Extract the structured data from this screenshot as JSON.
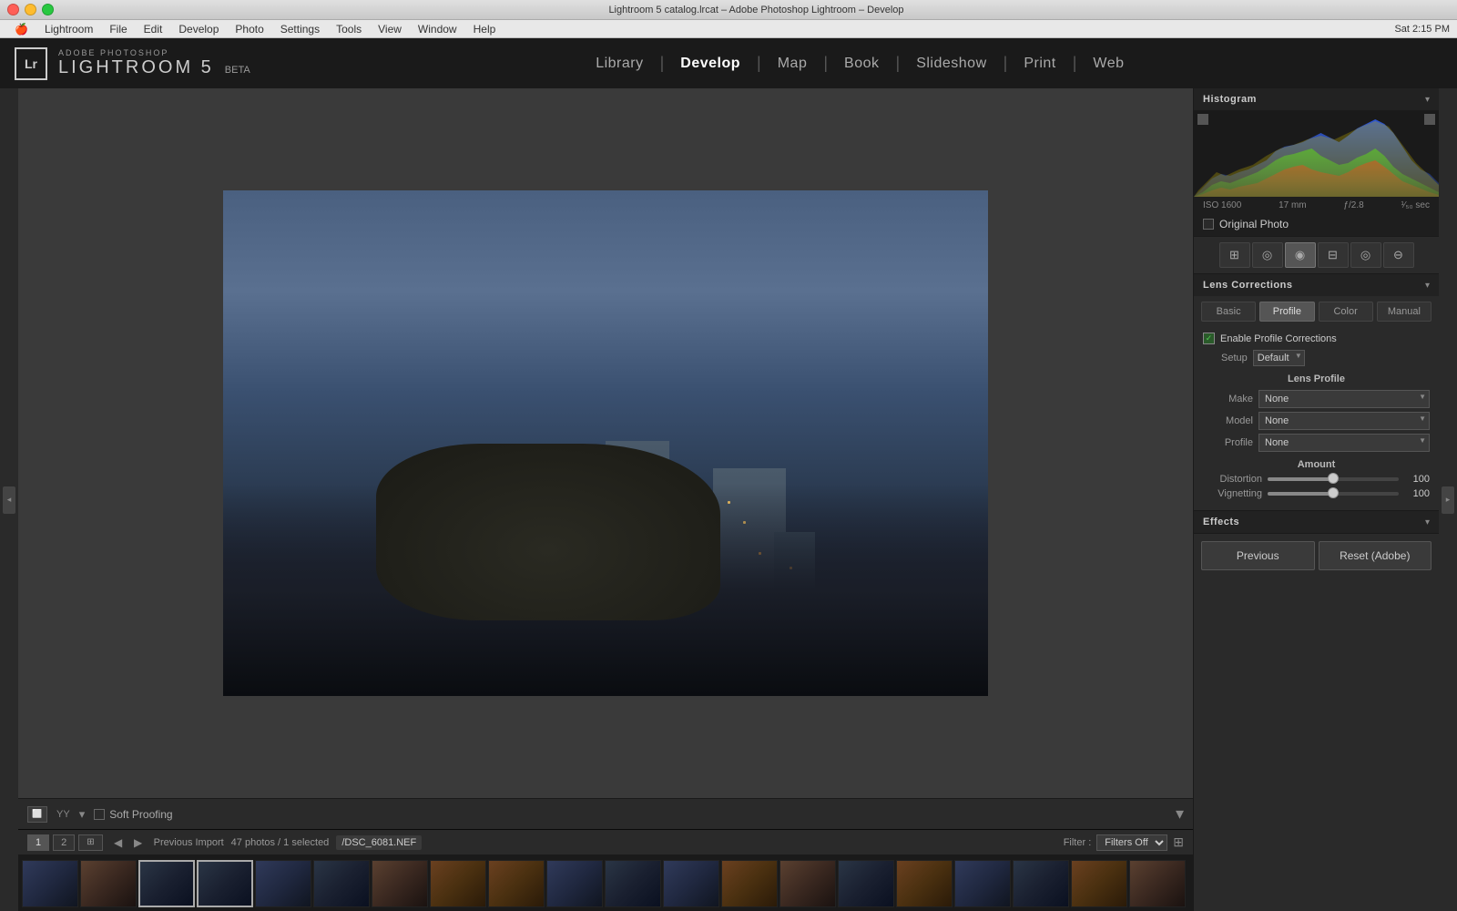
{
  "window": {
    "title": "Lightroom 5 catalog.lrcat – Adobe Photoshop Lightroom – Develop",
    "close_label": "×",
    "minimize_label": "–",
    "maximize_label": "+"
  },
  "mac_menu": {
    "items": [
      "🍎",
      "Lightroom",
      "File",
      "Edit",
      "Develop",
      "Photo",
      "Settings",
      "Tools",
      "View",
      "Window",
      "Help"
    ]
  },
  "app": {
    "logo_sub": "ADOBE PHOTOSHOP",
    "logo_main": "LIGHTROOM 5",
    "logo_beta": "BETA",
    "lr_icon": "Lr"
  },
  "nav": {
    "items": [
      "Library",
      "Develop",
      "Map",
      "Book",
      "Slideshow",
      "Print",
      "Web"
    ],
    "active": "Develop",
    "separators": [
      "|",
      "|",
      "|",
      "|",
      "|",
      "|"
    ]
  },
  "histogram": {
    "title": "Histogram",
    "meta": {
      "iso": "ISO 1600",
      "focal": "17 mm",
      "aperture": "ƒ/2.8",
      "shutter": "¹⁄₅₀ sec"
    },
    "original_photo_label": "Original Photo"
  },
  "tools": {
    "buttons": [
      "⊞",
      "◎",
      "◉",
      "⊟",
      "◎",
      "⊖"
    ]
  },
  "lens_corrections": {
    "title": "Lens Corrections",
    "tabs": [
      "Basic",
      "Profile",
      "Color",
      "Manual"
    ],
    "active_tab": "Profile",
    "enable_profile_label": "Enable Profile Corrections",
    "setup_label": "Setup",
    "setup_value": "Default",
    "lens_profile_title": "Lens Profile",
    "make_label": "Make",
    "make_value": "None",
    "model_label": "Model",
    "model_value": "None",
    "profile_label": "Profile",
    "profile_value": "None",
    "amount_title": "Amount",
    "distortion_label": "Distortion",
    "distortion_value": "100",
    "distortion_pct": 50,
    "vignetting_label": "Vignetting",
    "vignetting_value": "100",
    "vignetting_pct": 50
  },
  "effects": {
    "title": "Effects"
  },
  "bottom_buttons": {
    "previous_label": "Previous",
    "reset_label": "Reset (Adobe)"
  },
  "toolbar": {
    "soft_proofing_label": "Soft Proofing"
  },
  "filmstrip": {
    "tab1": "1",
    "tab2": "2",
    "import_label": "Previous Import",
    "photos_count": "47 photos / 1 selected",
    "file_name": "/DSC_6081.NEF",
    "filter_label": "Filter :",
    "filter_value": "Filters Off"
  }
}
